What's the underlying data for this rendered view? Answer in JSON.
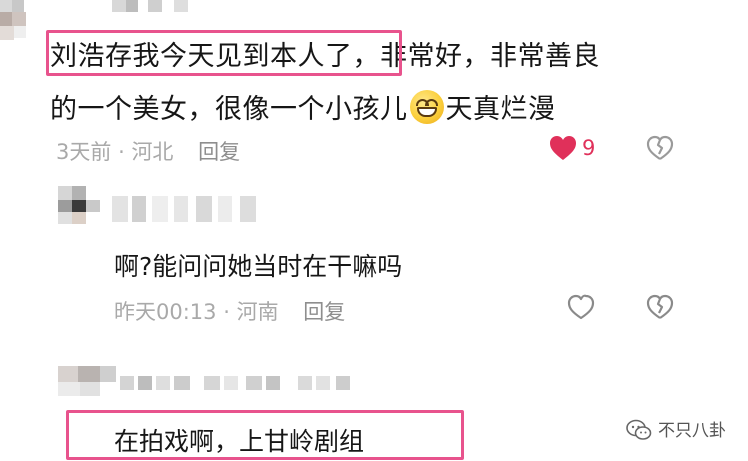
{
  "comments": [
    {
      "text_highlighted": "刘浩存我今天见到本人了",
      "text_line1_rest": "，非常好，非常善良",
      "text_line2_before": "的一个美女，很像一个小孩儿",
      "emoji": "grinning-face-emoji",
      "text_line2_after": "天真烂漫",
      "time": "3天前",
      "location": "河北",
      "reply_label": "回复",
      "likes": "9",
      "liked": true
    },
    {
      "text": "啊?能问问她当时在干嘛吗",
      "time": "昨天00:13",
      "location": "河南",
      "reply_label": "回复",
      "liked": false
    },
    {
      "text": "在拍戏啊，上甘岭剧组"
    }
  ],
  "meta_separator": "·",
  "watermark": {
    "text": "不只八卦",
    "icon": "wechat-icon"
  },
  "colors": {
    "highlight": "#e8538d",
    "like": "#e0305a",
    "meta": "#a9a9a9"
  }
}
